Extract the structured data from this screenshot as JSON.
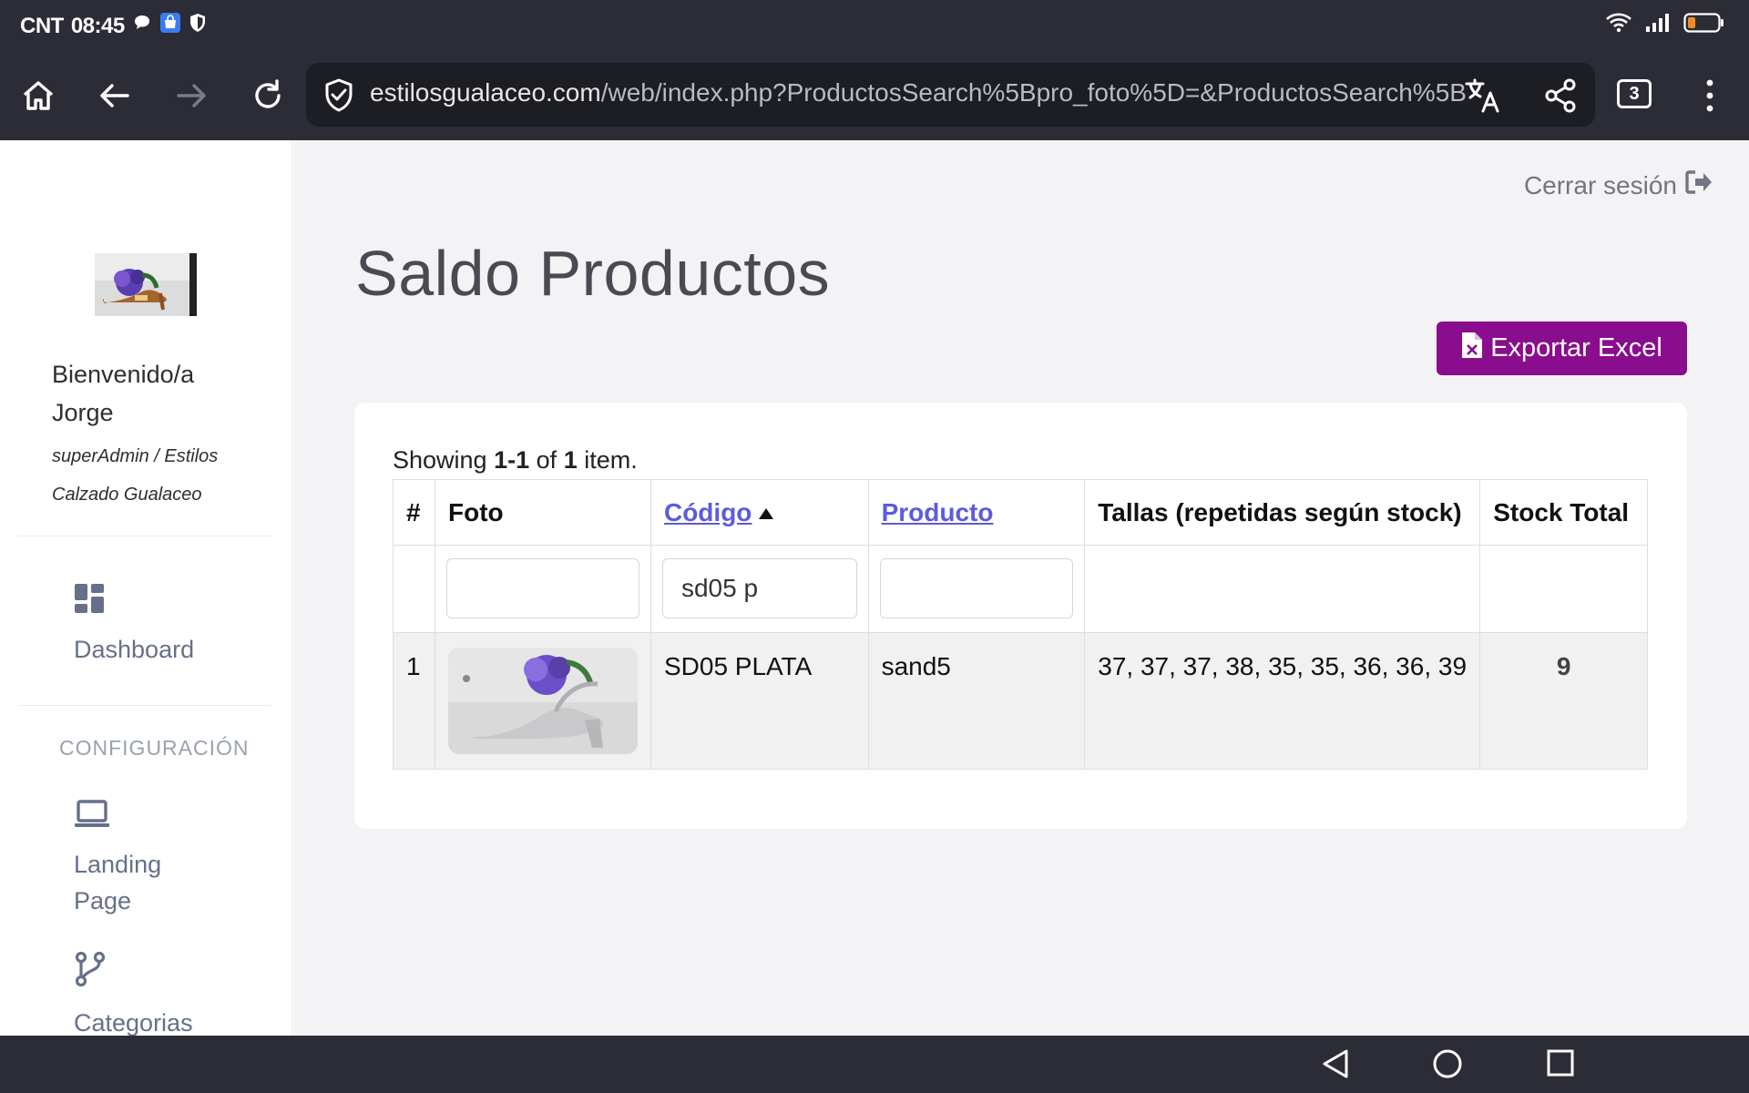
{
  "status_bar": {
    "carrier": "CNT",
    "time": "08:45",
    "battery_level": 0.25
  },
  "browser": {
    "url_host": "estilosgualaceo.com",
    "url_path": "/web/index.php?ProductosSearch%5Bpro_foto%5D=&ProductosSearch%5B",
    "tab_count": "3"
  },
  "sidebar": {
    "welcome_line1": "Bienvenido/a",
    "welcome_line2": "Jorge",
    "role_line1": "superAdmin / Estilos",
    "role_line2": "Calzado Gualaceo",
    "items": [
      {
        "label": "Dashboard",
        "icon": "dashboard-icon"
      },
      {
        "label": "Landing",
        "label2": "Page",
        "icon": "laptop-icon"
      },
      {
        "label": "Categorias",
        "icon": "branch-icon"
      }
    ],
    "section_title": "CONFIGURACIÓN"
  },
  "main": {
    "logout_label": "Cerrar sesión",
    "page_title": "Saldo Productos",
    "export_label": "Exportar Excel",
    "summary": {
      "prefix": "Showing",
      "range": "1-1",
      "of": "of",
      "total": "1",
      "suffix": "item."
    },
    "table": {
      "headers": [
        "#",
        "Foto",
        "Código",
        "Producto",
        "Tallas (repetidas según stock)",
        "Stock Total"
      ],
      "filters": {
        "foto": "",
        "codigo": "sd05 p",
        "producto": ""
      },
      "rows": [
        {
          "num": "1",
          "codigo": "SD05 PLATA",
          "producto": "sand5",
          "tallas": "37, 37, 37, 38, 35, 35, 36, 36, 39",
          "stock": "9"
        }
      ]
    }
  },
  "colors": {
    "accent": "#8a0d8e",
    "link": "#5b5be0",
    "chrome": "#2b2c35"
  }
}
